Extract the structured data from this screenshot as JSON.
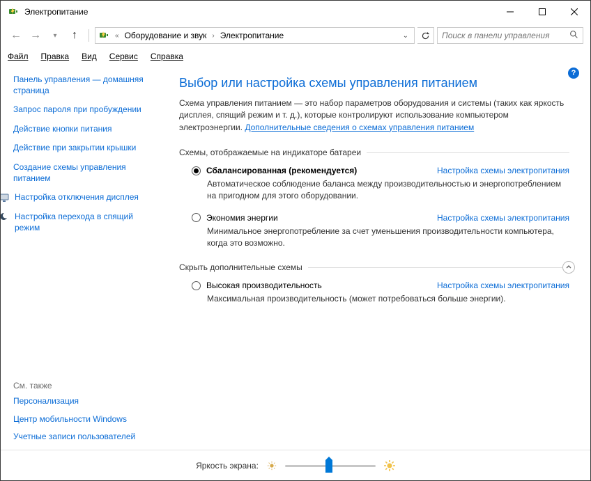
{
  "window": {
    "title": "Электропитание"
  },
  "nav": {
    "breadcrumb_prefix": "«",
    "crumb1": "Оборудование и звук",
    "crumb2": "Электропитание",
    "search_placeholder": "Поиск в панели управления"
  },
  "menubar": {
    "file": "Файл",
    "edit": "Правка",
    "view": "Вид",
    "service": "Сервис",
    "help": "Справка"
  },
  "sidebar": {
    "items": [
      "Панель управления — домашняя страница",
      "Запрос пароля при пробуждении",
      "Действие кнопки питания",
      "Действие при закрытии крышки",
      "Создание схемы управления питанием",
      "Настройка отключения дисплея",
      "Настройка перехода в спящий режим"
    ],
    "see_also_label": "См. также",
    "see_also": [
      "Персонализация",
      "Центр мобильности Windows",
      "Учетные записи пользователей"
    ]
  },
  "main": {
    "title": "Выбор или настройка схемы управления питанием",
    "intro_text": "Схема управления питанием — это набор параметров оборудования и системы (таких как яркость дисплея, спящий режим и т. д.), которые контролируют использование компьютером электроэнергии. ",
    "intro_link": "Дополнительные сведения о схемах управления питанием",
    "group1_label": "Схемы, отображаемые на индикаторе батареи",
    "group2_label": "Скрыть дополнительные схемы",
    "change_link": "Настройка схемы электропитания",
    "plans": {
      "balanced": {
        "name": "Сбалансированная (рекомендуется)",
        "desc": "Автоматическое соблюдение баланса между производительностью и энергопотреблением на пригодном для этого оборудовании."
      },
      "saver": {
        "name": "Экономия энергии",
        "desc": "Минимальное энергопотребление за счет уменьшения производительности компьютера, когда это возможно."
      },
      "high": {
        "name": "Высокая производительность",
        "desc": "Максимальная производительность (может потребоваться больше энергии)."
      }
    }
  },
  "footer": {
    "label": "Яркость экрана:"
  }
}
